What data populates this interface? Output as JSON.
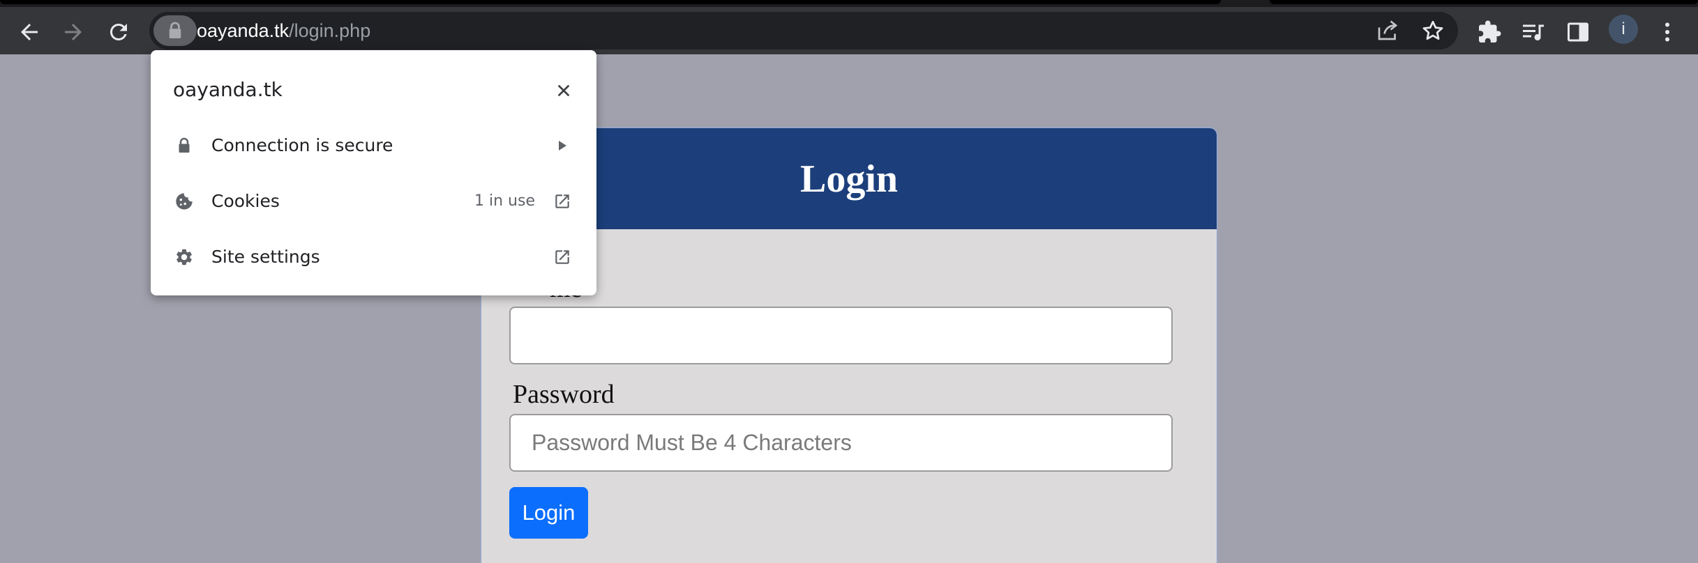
{
  "browser": {
    "url_host": "oayanda.tk",
    "url_path": "/login.php",
    "profile_initial": "i",
    "icons": {
      "back": "arrow-left-icon",
      "forward": "arrow-right-icon",
      "reload": "reload-icon",
      "lock": "lock-icon",
      "share": "share-icon",
      "bookmark": "star-icon",
      "extensions": "puzzle-icon",
      "media": "playlist-icon",
      "side_panel": "side-panel-icon",
      "menu": "kebab-menu-icon"
    }
  },
  "site_info_popup": {
    "domain": "oayanda.tk",
    "rows": [
      {
        "label": "Connection is secure",
        "icon": "lock-icon",
        "trail": "arrow-right-icon"
      },
      {
        "label": "Cookies",
        "meta": "1 in use",
        "icon": "cookie-icon",
        "trail": "open-external-icon"
      },
      {
        "label": "Site settings",
        "icon": "gear-icon",
        "trail": "open-external-icon"
      }
    ]
  },
  "login_page": {
    "title": "Login",
    "username_label": "me",
    "password_label": "Password",
    "password_placeholder": "Password Must Be 4 Characters",
    "submit_label": "Login"
  },
  "colors": {
    "page_bg": "#a0a1ad",
    "header_bg": "#1c3f7b",
    "card_bg": "#dcdadb",
    "button_bg": "#0b6efd",
    "toolbar_bg": "#35363a"
  }
}
